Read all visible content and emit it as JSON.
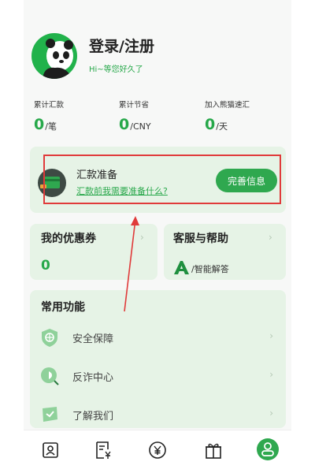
{
  "header": {
    "title": "登录/注册",
    "subtitle": "Hi~等您好久了"
  },
  "stats": [
    {
      "label": "累计汇款",
      "value": "0",
      "unit": "/笔"
    },
    {
      "label": "累计节省",
      "value": "0",
      "unit": "/CNY"
    },
    {
      "label": "加入熊猫速汇",
      "value": "0",
      "unit": "/天"
    }
  ],
  "remit": {
    "title": "汇款准备",
    "link": "汇款前我需要准备什么?",
    "button": "完善信息"
  },
  "coupon": {
    "title": "我的优惠券",
    "count": "0"
  },
  "help": {
    "title": "客服与帮助",
    "ai_label": "/智能解答"
  },
  "functions": {
    "title": "常用功能",
    "items": [
      {
        "label": "安全保障",
        "icon": "shield-icon"
      },
      {
        "label": "反诈中心",
        "icon": "anti-fraud-icon"
      },
      {
        "label": "了解我们",
        "icon": "about-icon"
      }
    ]
  },
  "tabs": [
    "contacts-tab-icon",
    "bill-tab-icon",
    "yuan-tab-icon",
    "gift-tab-icon",
    "profile-tab-icon"
  ],
  "colors": {
    "accent": "#2fa84f",
    "card": "#e6f3e6",
    "highlight": "#e03a3a"
  }
}
